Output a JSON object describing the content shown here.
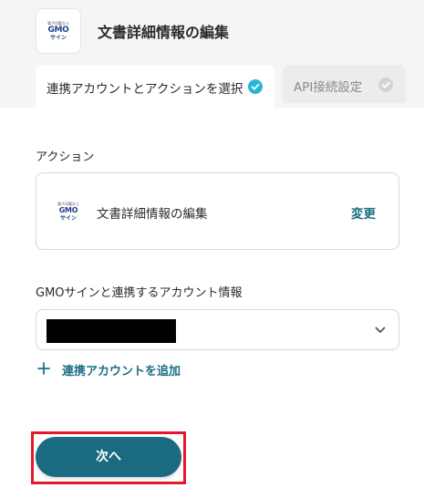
{
  "header": {
    "title": "文書詳細情報の編集",
    "logo": {
      "tagline": "電子印鑑なら",
      "brand": "GMO",
      "product": "サイン"
    }
  },
  "tabs": [
    {
      "label": "連携アカウントとアクションを選択",
      "state": "active",
      "check_color": "#29b6d6"
    },
    {
      "label": "API接続設定",
      "state": "inactive",
      "check_color": "#d4d4d4"
    }
  ],
  "action_section": {
    "label": "アクション",
    "card": {
      "name": "文書詳細情報の編集",
      "change_label": "変更",
      "logo": {
        "tagline": "電子印鑑なら",
        "brand": "GMO",
        "product": "サイン"
      }
    }
  },
  "account_section": {
    "label": "GMOサインと連携するアカウント情報",
    "select_value_redacted": true,
    "add_account_label": "連携アカウントを追加"
  },
  "footer": {
    "next_label": "次へ"
  },
  "colors": {
    "accent": "#1a6a80",
    "link": "#1b6f86",
    "highlight_border": "#e4182b",
    "check_active": "#29b6d6"
  },
  "icons": [
    "gmo-sign-logo",
    "check-circle-icon",
    "chevron-down-icon",
    "plus-icon"
  ]
}
